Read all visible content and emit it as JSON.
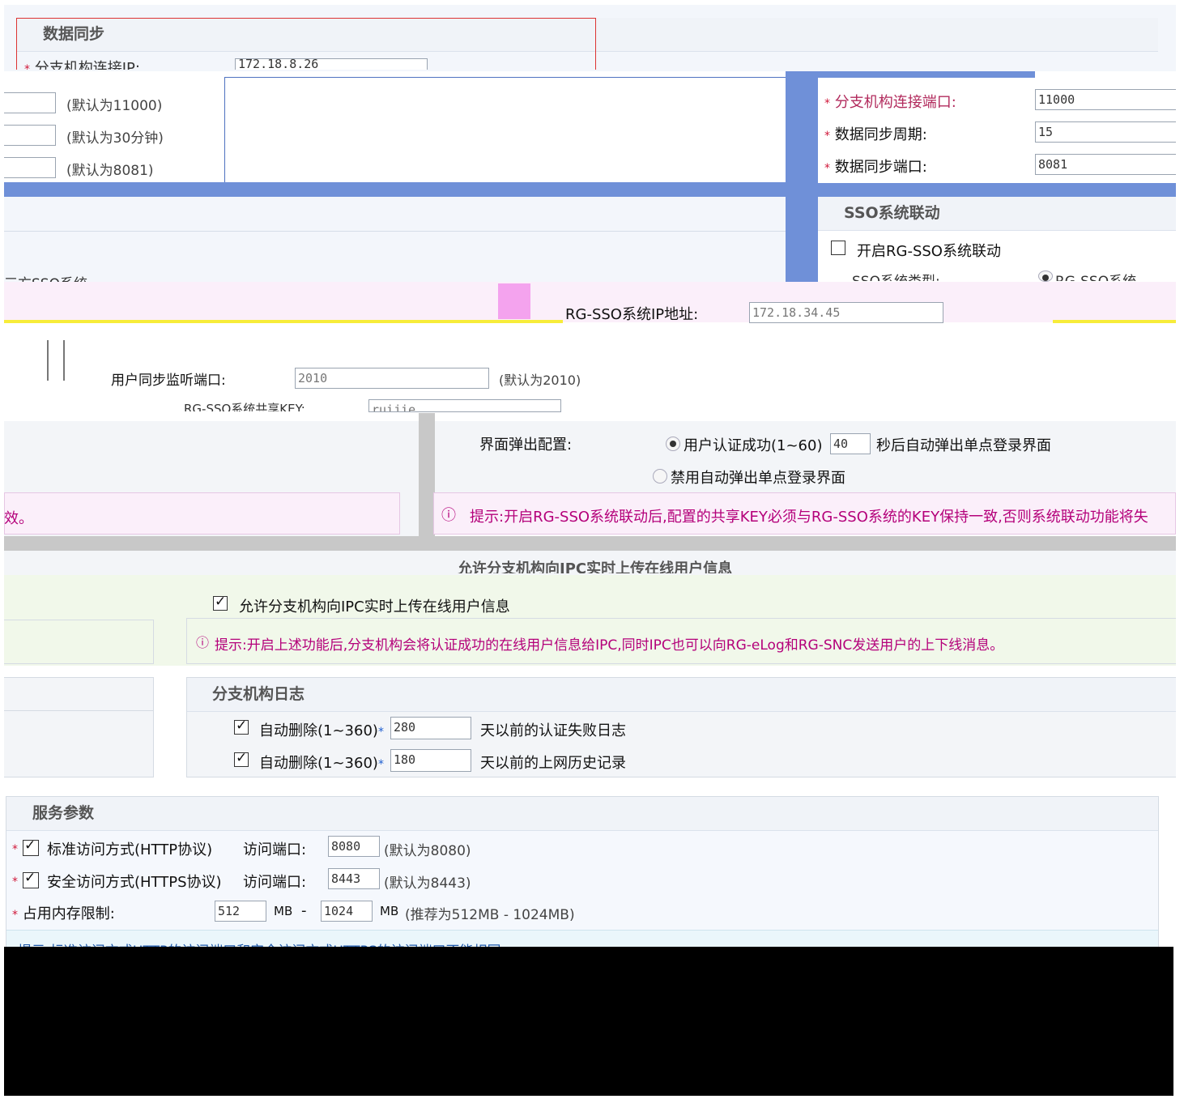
{
  "sync": {
    "title": "数据同步",
    "branch_ip_label": "分支机构连接IP:",
    "branch_ip_value": "172.18.8.26",
    "hint_port": "(默认为11000)",
    "hint_period": "(默认为30分钟)",
    "hint_sync_port": "(默认为8081)",
    "port_label": "分支机构连接端口:",
    "port_value": "11000",
    "period_label": "数据同步周期:",
    "period_value": "15",
    "sync_port_label": "数据同步端口:",
    "sync_port_value": "8081"
  },
  "sso": {
    "title": "SSO系统联动",
    "enable_label": "开启RG-SSO系统联动",
    "type_label": "SSO系统类型:",
    "type_option": "RG-SSO系统",
    "third_party_label": "三方SSO系统",
    "ip_label": "RG-SSO系统IP地址:",
    "ip_value": "172.18.34.45",
    "listen_port_label": "用户同步监听端口:",
    "listen_port_value": "2010",
    "listen_port_hint": "(默认为2010)",
    "key_label": "RG-SSO系统共享KEY:",
    "key_value": "ruijie",
    "popup_label": "界面弹出配置:",
    "popup_option1_prefix": "用户认证成功(1~60)",
    "popup_seconds": "40",
    "popup_option1_suffix": "秒后自动弹出单点登录界面",
    "popup_option2": "禁用自动弹出单点登录界面",
    "tip": "提示:开启RG-SSO系统联动后,配置的共享KEY必须与RG-SSO系统的KEY保持一致,否则系统联动功能将失",
    "left_fragment": "效。"
  },
  "ipc": {
    "title": "允许分支机构向IPC实时上传在线用户信息",
    "checkbox_label": "允许分支机构向IPC实时上传在线用户信息",
    "tip": "提示:开启上述功能后,分支机构会将认证成功的在线用户信息给IPC,同时IPC也可以向RG-eLog和RG-SNC发送用户的上下线消息。"
  },
  "log": {
    "title": "分支机构日志",
    "row1_prefix": "自动删除(1~360)",
    "row1_value": "280",
    "row1_suffix": "天以前的认证失败日志",
    "row2_prefix": "自动删除(1~360)",
    "row2_value": "180",
    "row2_suffix": "天以前的上网历史记录"
  },
  "service": {
    "title": "服务参数",
    "http_label": "标准访问方式(HTTP协议)",
    "port_label": "访问端口:",
    "http_port": "8080",
    "http_hint": "(默认为8080)",
    "https_label": "安全访问方式(HTTPS协议)",
    "https_port": "8443",
    "https_hint": "(默认为8443)",
    "mem_label": "占用内存限制:",
    "mem_min": "512",
    "mem_unit": "MB",
    "mem_dash": "-",
    "mem_max": "1024",
    "mem_hint": "(推荐为512MB - 1024MB)",
    "tip_fragment": "提示:标准访问方式HTTP的访问端口和安全访问方式HTTPS的访问端口不能相同"
  },
  "colors": {
    "accent_blue": "#6f90d8",
    "star_red": "#d0183a",
    "tip_magenta": "#b4007a",
    "ipc_green": "#f1f8ea",
    "sso_pink": "#fbeffa"
  }
}
